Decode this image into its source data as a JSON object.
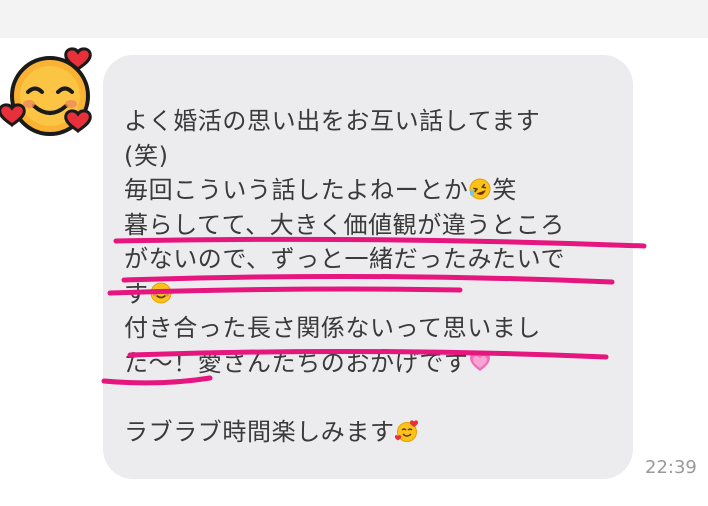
{
  "message": {
    "line1": "よく婚活の思い出をお互い話してます",
    "line2": "(笑)",
    "line3_text": "毎回こういう話したよねーとか",
    "line3_emoji": "rofl-emoji",
    "line3_end": "笑",
    "line4": "暮らしてて、大きく価値観が違うところ",
    "line5": "がないので、ずっと一緒だったみたいで",
    "line6_text": "す",
    "line6_emoji": "smiling-emoji",
    "line7": "付き合った長さ関係ないって思いまし",
    "line8_text": "た〜！愛さんたちのおかげです",
    "line8_emoji": "heart-emoji",
    "line9": "",
    "line10_text": "ラブラブ時間楽しみます",
    "line10_emoji": "hearts-face-emoji",
    "time": "22:39"
  },
  "sender": {
    "avatar": "smiling-face-with-hearts-emoji"
  },
  "colors": {
    "bubble": "#ececef",
    "text": "#3a3a3a",
    "highlight": "#e5167e",
    "time": "#9a9a9a",
    "topband": "#f3f3f3"
  }
}
